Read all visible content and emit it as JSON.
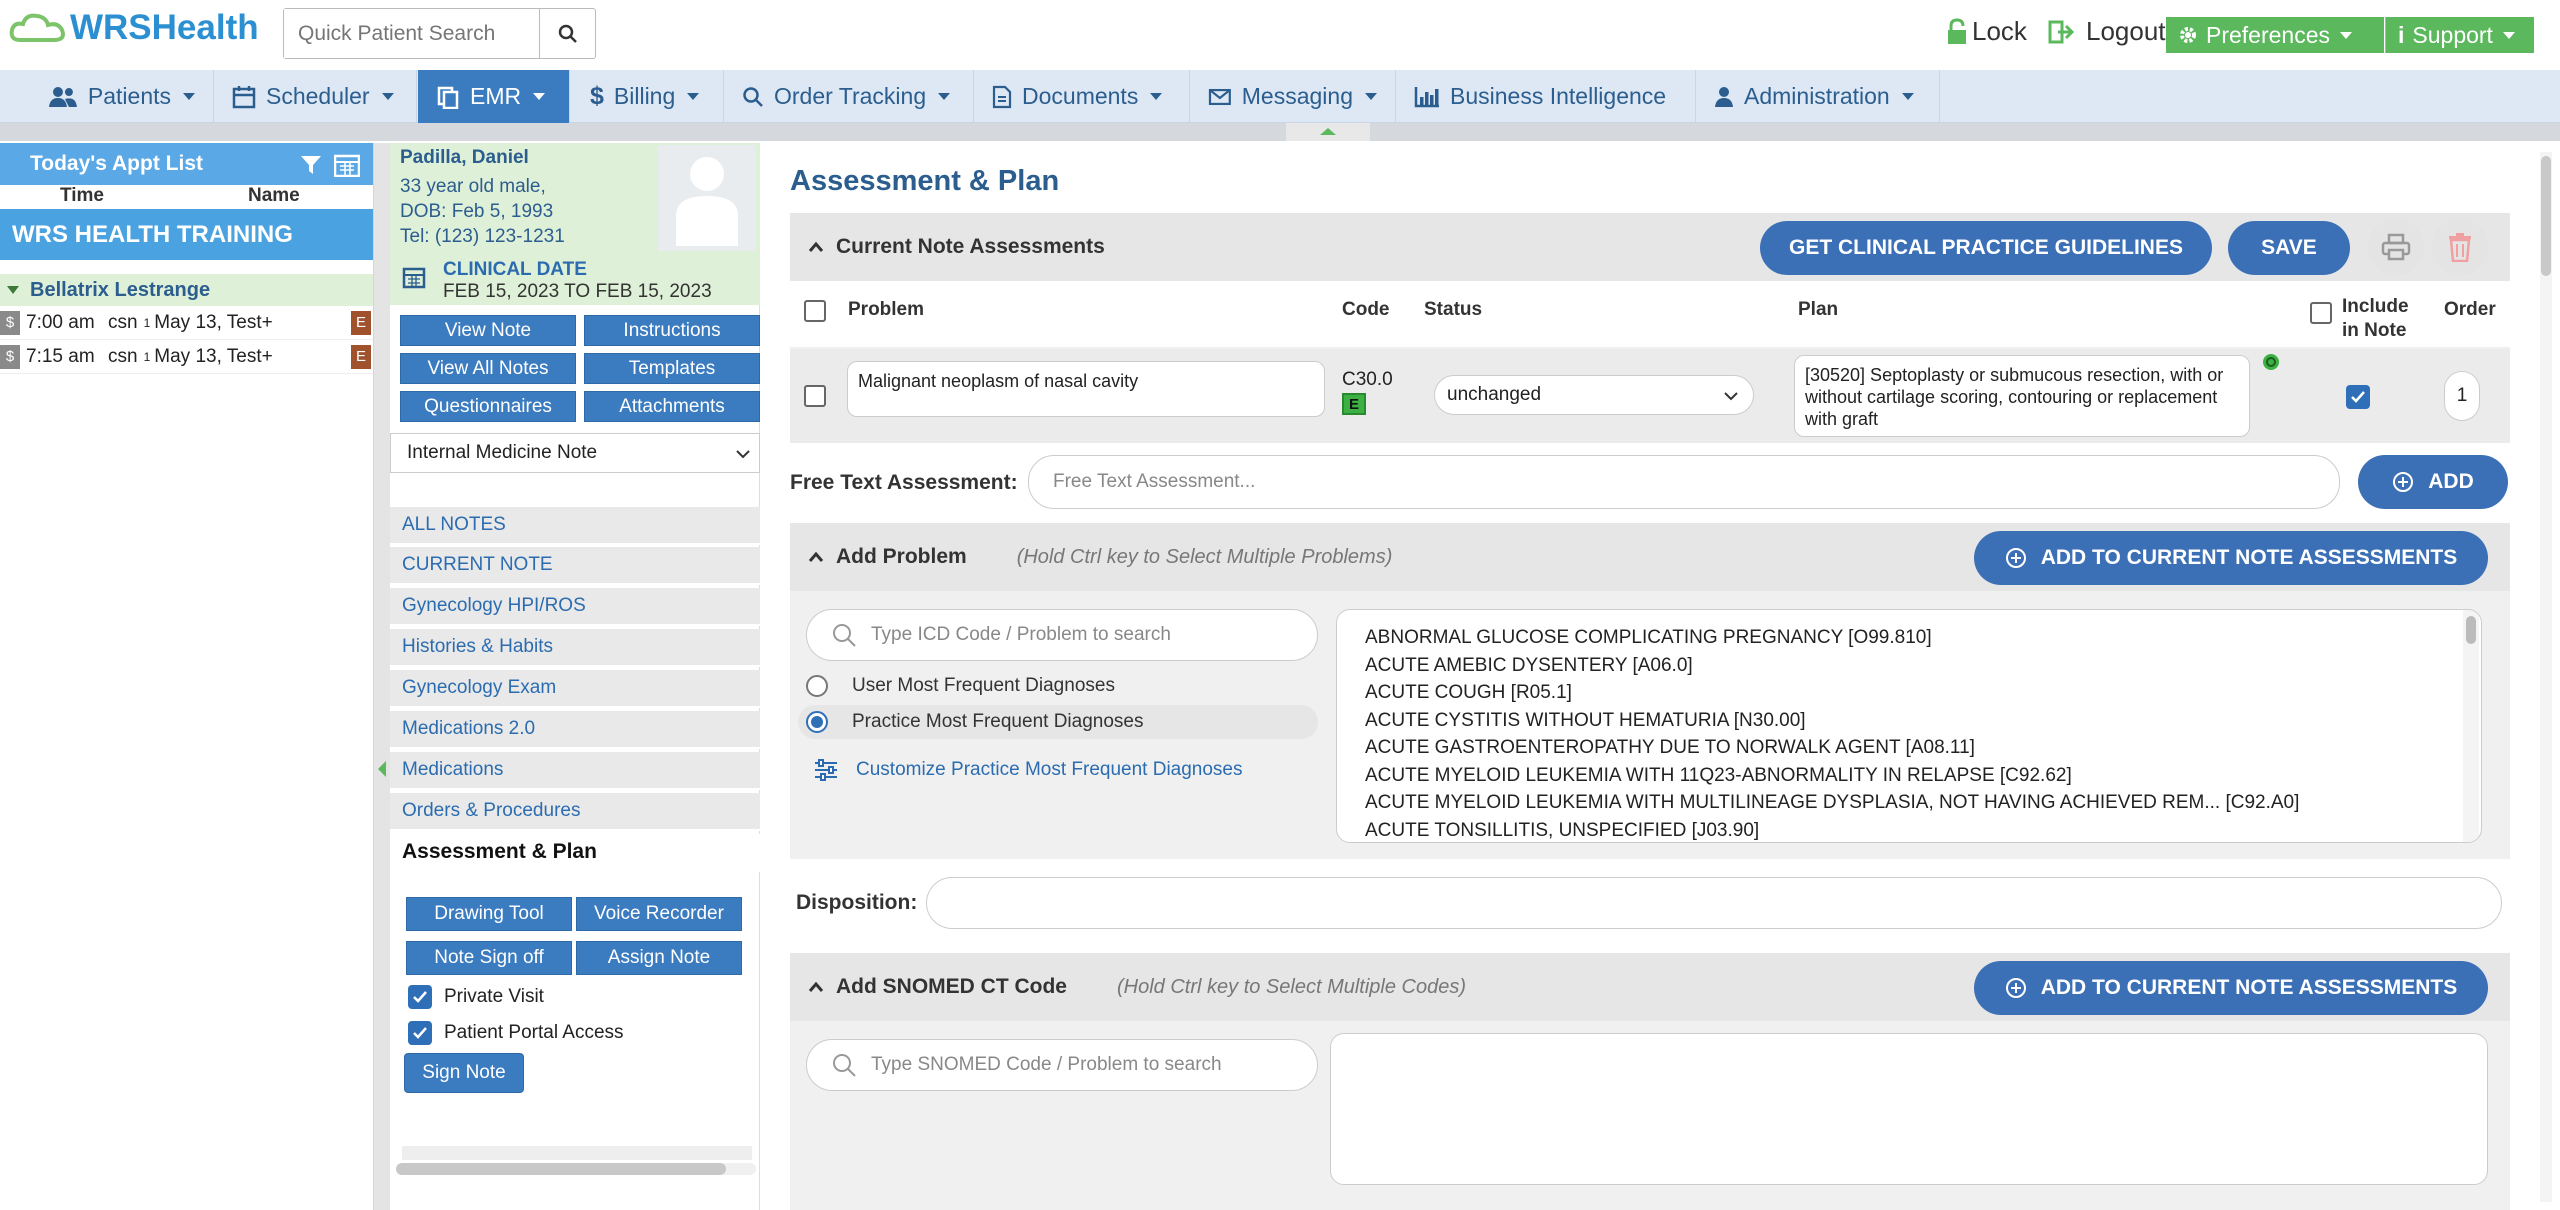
{
  "app": {
    "logo_text": "WRSHealth",
    "quick_search_placeholder": "Quick Patient Search",
    "lock_label": "Lock",
    "logout_label": "Logout",
    "preferences_label": "Preferences",
    "support_label": "Support"
  },
  "nav": [
    {
      "label": "Patients",
      "icon": "users-icon"
    },
    {
      "label": "Scheduler",
      "icon": "calendar-icon"
    },
    {
      "label": "EMR",
      "icon": "copy-icon",
      "active": true
    },
    {
      "label": "Billing",
      "icon": "dollar-icon"
    },
    {
      "label": "Order Tracking",
      "icon": "search-icon"
    },
    {
      "label": "Documents",
      "icon": "document-icon"
    },
    {
      "label": "Messaging",
      "icon": "envelope-icon"
    },
    {
      "label": "Business Intelligence",
      "icon": "bar-chart-icon"
    },
    {
      "label": "Administration",
      "icon": "user-icon"
    }
  ],
  "appt_list": {
    "title": "Today's Appt List",
    "col_time": "Time",
    "col_name": "Name",
    "group": "WRS HEALTH TRAINING",
    "patient": "Bellatrix Lestrange",
    "rows": [
      {
        "time": "7:00 am",
        "code": "csn",
        "sup": "1",
        "date": "May 13, Test+",
        "badge": "E",
        "dollar": "$"
      },
      {
        "time": "7:15 am",
        "code": "csn",
        "sup": "1",
        "date": "May 13, Test+",
        "badge": "E",
        "dollar": "$"
      }
    ]
  },
  "patient": {
    "name": "Padilla, Daniel",
    "age_sex": "33 year old male,",
    "dob": "DOB: Feb 5, 1993",
    "tel": "Tel: (123) 123-1231",
    "clinical_date_label": "CLINICAL DATE",
    "clinical_date": "FEB 15, 2023 TO FEB 15, 2023"
  },
  "note_buttons": {
    "view_note": "View Note",
    "instructions": "Instructions",
    "view_all_notes": "View All Notes",
    "templates": "Templates",
    "questionnaires": "Questionnaires",
    "attachments": "Attachments"
  },
  "note_type": "Internal Medicine Note",
  "note_sections": [
    "ALL NOTES",
    "CURRENT NOTE",
    "Gynecology HPI/ROS",
    "Histories & Habits",
    "Gynecology Exam",
    "Medications 2.0",
    "Medications",
    "Orders & Procedures"
  ],
  "current_section": "Assessment & Plan",
  "tools": {
    "drawing_tool": "Drawing Tool",
    "voice_recorder": "Voice Recorder",
    "note_sign_off": "Note Sign off",
    "assign_note": "Assign Note",
    "private_visit": "Private Visit",
    "patient_portal_access": "Patient Portal Access",
    "sign_note": "Sign Note"
  },
  "main": {
    "title": "Assessment & Plan",
    "current_assessments": {
      "heading": "Current Note Assessments",
      "guidelines_button": "GET CLINICAL PRACTICE GUIDELINES",
      "save_button": "SAVE",
      "col_problem": "Problem",
      "col_code": "Code",
      "col_status": "Status",
      "col_plan": "Plan",
      "col_include": "Include in Note",
      "col_order": "Order",
      "row": {
        "problem": "Malignant neoplasm of nasal cavity",
        "code": "C30.0",
        "code_badge": "E",
        "status": "unchanged",
        "plan": "[30520] Septoplasty or submucous resection, with or without cartilage scoring, contouring or replacement with graft",
        "include": true,
        "order": "1"
      }
    },
    "free_text": {
      "label": "Free Text Assessment:",
      "placeholder": "Free Text Assessment...",
      "add_button": "ADD"
    },
    "add_problem": {
      "heading": "Add Problem",
      "hint": "(Hold Ctrl key to Select Multiple Problems)",
      "add_button": "ADD TO CURRENT NOTE ASSESSMENTS",
      "search_placeholder": "Type ICD Code / Problem to search",
      "option_user": "User Most Frequent Diagnoses",
      "option_practice": "Practice Most Frequent Diagnoses",
      "customize_link": "Customize Practice Most Frequent Diagnoses",
      "diagnoses": [
        "ABNORMAL GLUCOSE COMPLICATING PREGNANCY [O99.810]",
        "ACUTE AMEBIC DYSENTERY [A06.0]",
        "ACUTE COUGH [R05.1]",
        "ACUTE CYSTITIS WITHOUT HEMATURIA [N30.00]",
        "ACUTE GASTROENTEROPATHY DUE TO NORWALK AGENT [A08.11]",
        "ACUTE MYELOID LEUKEMIA WITH 11Q23-ABNORMALITY IN RELAPSE [C92.62]",
        "ACUTE MYELOID LEUKEMIA WITH MULTILINEAGE DYSPLASIA, NOT HAVING ACHIEVED REM... [C92.A0]",
        "ACUTE TONSILLITIS, UNSPECIFIED [J03.90]"
      ]
    },
    "disposition_label": "Disposition:",
    "snomed": {
      "heading": "Add SNOMED CT Code",
      "hint": "(Hold Ctrl key to Select Multiple Codes)",
      "add_button": "ADD TO CURRENT NOTE ASSESSMENTS",
      "search_placeholder": "Type SNOMED Code / Problem to search"
    }
  },
  "colors": {
    "primary": "#3b6fb6",
    "nav_bg": "#dde8f4",
    "green": "#5cb85c",
    "patient_bg": "#dff0d8"
  }
}
